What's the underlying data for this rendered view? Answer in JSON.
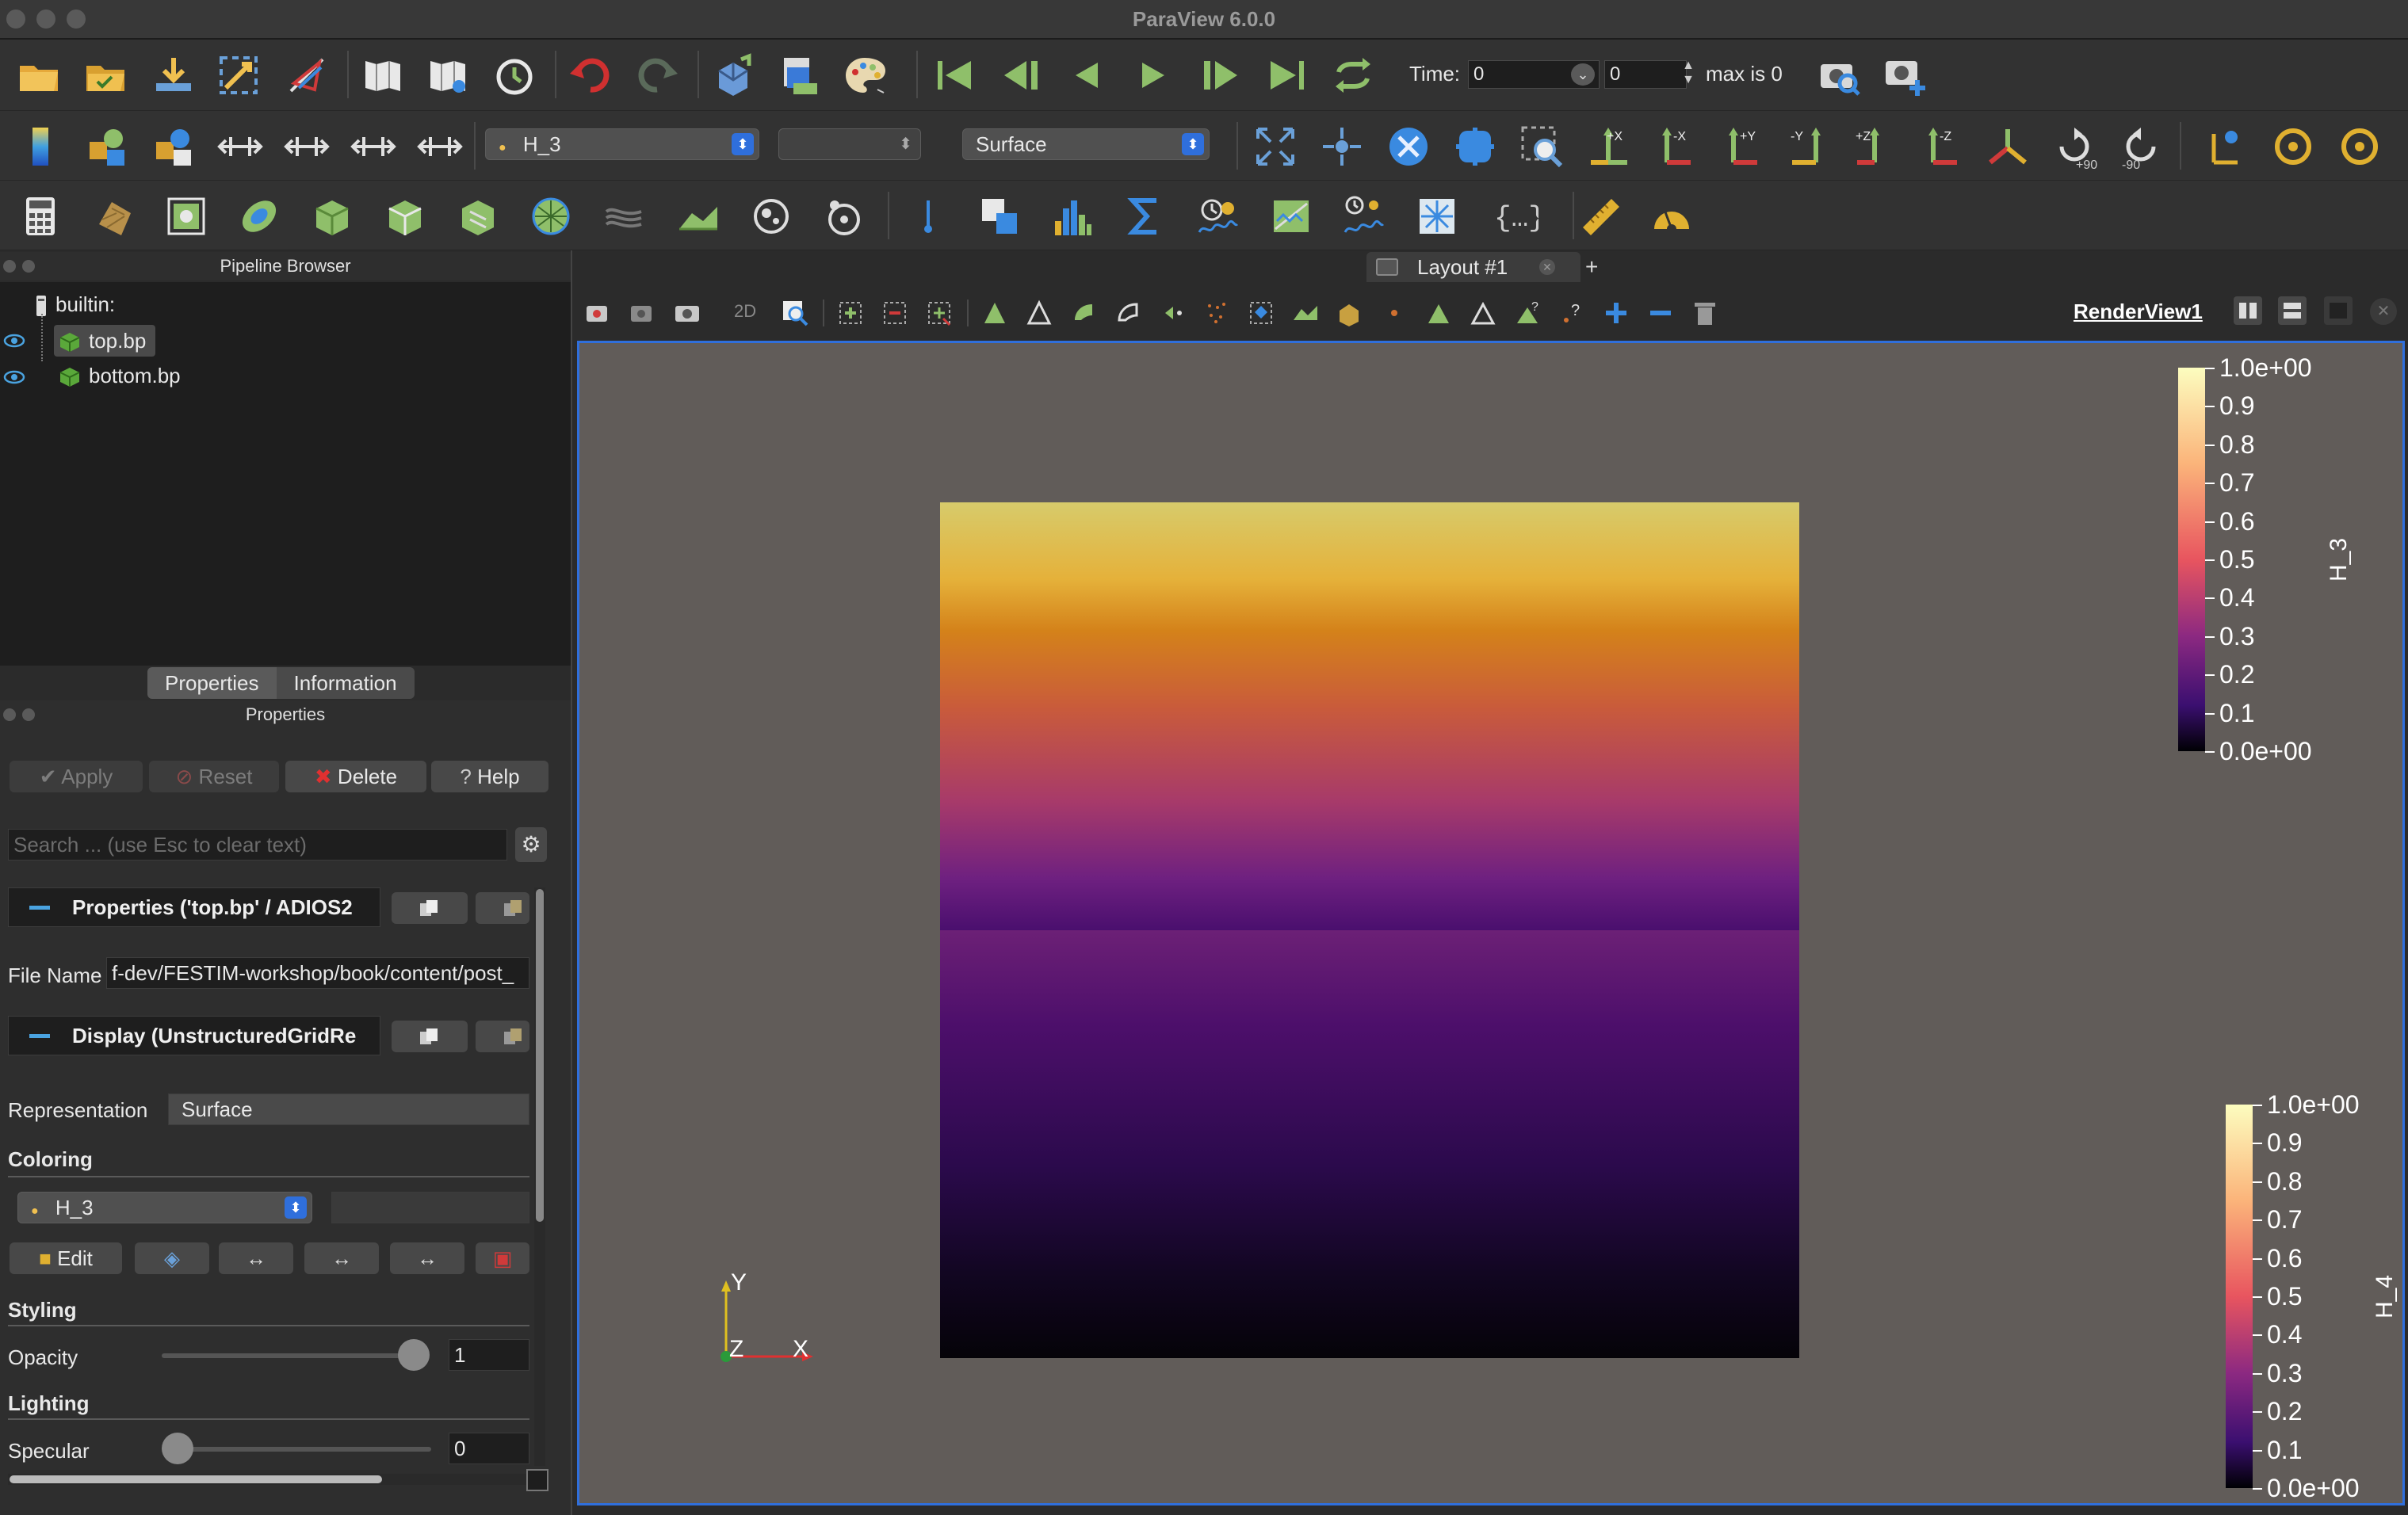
{
  "window": {
    "title": "ParaView 6.0.0"
  },
  "toolbar_main": {
    "time_label": "Time:",
    "time_value": "0",
    "timestep_value": "0",
    "max_label": "max is 0",
    "buttons": [
      "open-folder",
      "open-recent",
      "save-data",
      "connect",
      "color-legend",
      "save-state",
      "load-state",
      "reset-session",
      "undo",
      "redo",
      "disconnect",
      "screenshot",
      "palette",
      "first-frame",
      "prev-frame",
      "step-back",
      "play",
      "step-forward",
      "next-frame",
      "last-frame",
      "loop",
      "capture",
      "capture-add"
    ]
  },
  "toolbar_display": {
    "color_by": "H_3",
    "component": "",
    "representation": "Surface",
    "rotate_pos": "+90",
    "rotate_neg": "-90",
    "axis_labels": [
      "+X",
      "-X",
      "+Y",
      "-Y",
      "+Z",
      "-Z"
    ]
  },
  "pipeline": {
    "header": "Pipeline Browser",
    "root": "builtin:",
    "items": [
      {
        "name": "top.bp",
        "selected": true
      },
      {
        "name": "bottom.bp",
        "selected": false
      }
    ]
  },
  "tabs": {
    "properties": "Properties",
    "information": "Information"
  },
  "properties": {
    "header": "Properties",
    "apply": "Apply",
    "reset": "Reset",
    "delete": "Delete",
    "help": "Help",
    "search_placeholder": "Search ... (use Esc to clear text)",
    "section_props": "Properties ('top.bp' / ADIOS2",
    "file_name_label": "File Name",
    "file_name_value": "f-dev/FESTIM-workshop/book/content/post_",
    "section_display": "Display (UnstructuredGridRe",
    "representation_label": "Representation",
    "representation_value": "Surface",
    "coloring_label": "Coloring",
    "coloring_value": "H_3",
    "edit_label": "Edit",
    "styling_label": "Styling",
    "opacity_label": "Opacity",
    "opacity_value": "1",
    "opacity_level": 1.0,
    "lighting_label": "Lighting",
    "specular_label": "Specular",
    "specular_value": "0",
    "specular_level": 0.0
  },
  "layout": {
    "tab_label": "Layout #1",
    "add_tab": "+",
    "view_name": "RenderView1",
    "view_2d": "2D"
  },
  "colorbars": [
    {
      "title": "H_3",
      "ticks": [
        "1.0e+00",
        "0.9",
        "0.8",
        "0.7",
        "0.6",
        "0.5",
        "0.4",
        "0.3",
        "0.2",
        "0.1",
        "0.0e+00"
      ]
    },
    {
      "title": "H_4",
      "ticks": [
        "1.0e+00",
        "0.9",
        "0.8",
        "0.7",
        "0.6",
        "0.5",
        "0.4",
        "0.3",
        "0.2",
        "0.1",
        "0.0e+00"
      ]
    }
  ],
  "orientation_axes": {
    "y": "Y",
    "z": "Z",
    "x": "X"
  },
  "colors": {
    "accent": "#2f6fdc",
    "delete_icon": "#e03030",
    "undo": "#d03030",
    "toolbar_green": "#8fbf6a"
  }
}
